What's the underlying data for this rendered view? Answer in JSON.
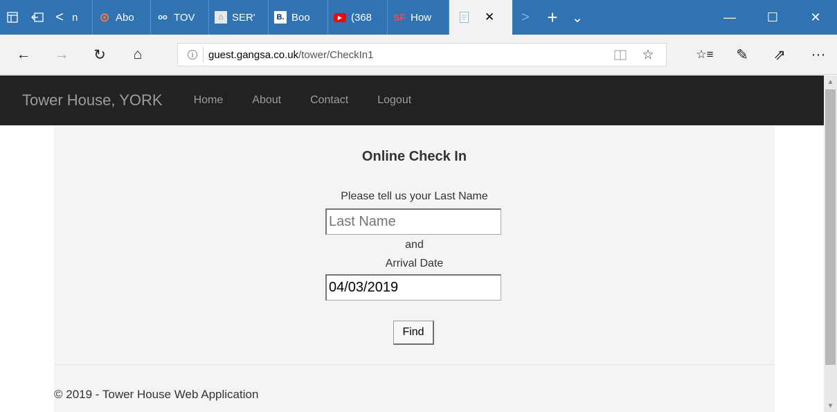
{
  "browser": {
    "tab_icons": {
      "tab_preview": "tab-preview-icon",
      "set_aside": "set-aside-tabs-icon",
      "scroll_left": "<"
    },
    "tabs": [
      {
        "title": "n",
        "favicon_text": "",
        "favicon_color": "#ffffff"
      },
      {
        "title": "Abo",
        "favicon_text": "⊙",
        "favicon_color": "#ff7a45"
      },
      {
        "title": "TOV",
        "favicon_text": "oo",
        "favicon_color": "#ffffff"
      },
      {
        "title": "SER'",
        "favicon_text": "⌂",
        "favicon_color": "#cfcfcf"
      },
      {
        "title": "Boo",
        "favicon_text": "B.",
        "favicon_color": "#003580"
      },
      {
        "title": "(368",
        "favicon_text": "▶",
        "favicon_color": "#ff0000"
      },
      {
        "title": "How",
        "favicon_text": "SF",
        "favicon_color": "#e12b2b"
      }
    ],
    "active_tab_close": "✕",
    "tab_scroll_right": ">",
    "new_tab": "+",
    "tab_list": "⌄",
    "window_controls": {
      "minimize": "—",
      "maximize": "☐",
      "close": "✕"
    },
    "nav": {
      "back": "←",
      "forward": "→",
      "refresh": "↻",
      "home": "⌂"
    },
    "address": {
      "domain": "guest.gangsa.co.uk",
      "path": "/tower/CheckIn1"
    },
    "address_buttons": {
      "reading_view": "📖",
      "favorite": "☆"
    },
    "toolbar": {
      "favorites_hub": "☆≡",
      "notes": "✎",
      "share": "⇗",
      "more": "···"
    }
  },
  "site": {
    "brand": "Tower House, YORK",
    "nav_links": [
      "Home",
      "About",
      "Contact",
      "Logout"
    ],
    "page_title": "Online Check In",
    "last_name_prompt": "Please tell us your Last Name",
    "last_name_placeholder": "Last Name",
    "and_text": "and",
    "arrival_label": "Arrival Date",
    "arrival_value": "04/03/2019",
    "find_label": "Find",
    "footer": "© 2019 - Tower House Web Application"
  },
  "colors": {
    "tabstrip": "#2f73b3",
    "site_navbar": "#222222",
    "content_bg": "#f4f4f4"
  }
}
